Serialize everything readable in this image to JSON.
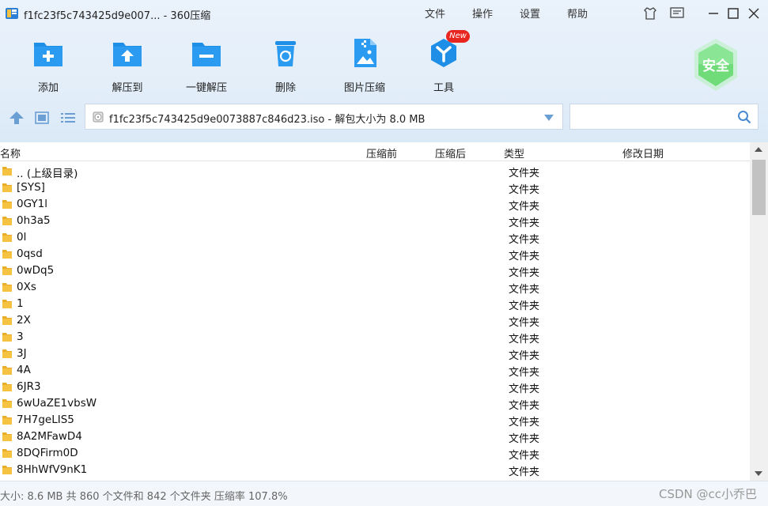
{
  "window": {
    "title": "f1fc23f5c743425d9e007... - 360压缩",
    "menu": [
      "文件",
      "操作",
      "设置",
      "帮助"
    ]
  },
  "toolbar": {
    "items": [
      {
        "label": "添加",
        "icon": "add-archive-icon"
      },
      {
        "label": "解压到",
        "icon": "extract-to-icon"
      },
      {
        "label": "一键解压",
        "icon": "one-click-extract-icon"
      },
      {
        "label": "删除",
        "icon": "recycle-bin-icon"
      },
      {
        "label": "图片压缩",
        "icon": "image-compress-icon"
      },
      {
        "label": "工具",
        "icon": "tools-icon",
        "badge": "New"
      }
    ],
    "safe_badge": "安全"
  },
  "pathbar": {
    "path": "f1fc23f5c743425d9e0073887c846d23.iso - 解包大小为 8.0 MB",
    "search_placeholder": ""
  },
  "columns": [
    "名称",
    "压缩前",
    "压缩后",
    "类型",
    "修改日期"
  ],
  "files": [
    {
      "name": ".. (上级目录)",
      "type": "文件夹"
    },
    {
      "name": "[SYS]",
      "type": "文件夹"
    },
    {
      "name": "0GY1l",
      "type": "文件夹"
    },
    {
      "name": "0h3a5",
      "type": "文件夹"
    },
    {
      "name": "0l",
      "type": "文件夹"
    },
    {
      "name": "0qsd",
      "type": "文件夹"
    },
    {
      "name": "0wDq5",
      "type": "文件夹"
    },
    {
      "name": "0Xs",
      "type": "文件夹"
    },
    {
      "name": "1",
      "type": "文件夹"
    },
    {
      "name": "2X",
      "type": "文件夹"
    },
    {
      "name": "3",
      "type": "文件夹"
    },
    {
      "name": "3J",
      "type": "文件夹"
    },
    {
      "name": "4A",
      "type": "文件夹"
    },
    {
      "name": "6JR3",
      "type": "文件夹"
    },
    {
      "name": "6wUaZE1vbsW",
      "type": "文件夹"
    },
    {
      "name": "7H7geLIS5",
      "type": "文件夹"
    },
    {
      "name": "8A2MFawD4",
      "type": "文件夹"
    },
    {
      "name": "8DQFirm0D",
      "type": "文件夹"
    },
    {
      "name": "8HhWfV9nK1",
      "type": "文件夹"
    }
  ],
  "status": {
    "text": "大小: 8.6 MB 共 860 个文件和 842 个文件夹 压缩率 107.8%",
    "watermark": "CSDN @cc小乔巴"
  },
  "colors": {
    "accent": "#1e8ee6",
    "folder": "#f5c242",
    "new_badge": "#e8251f",
    "safe_badge": "#5fd26a"
  }
}
